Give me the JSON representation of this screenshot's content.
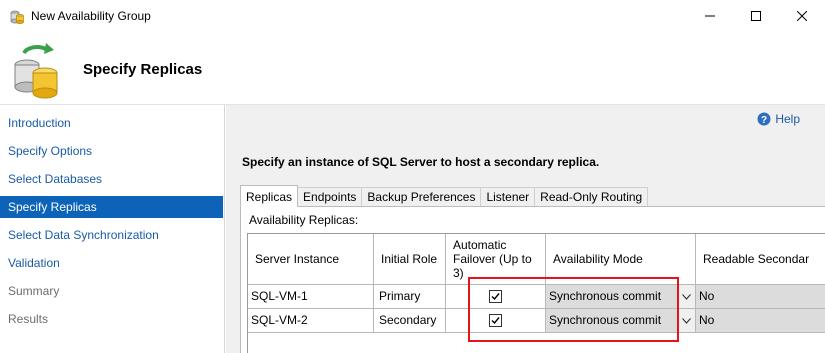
{
  "window": {
    "title": "New Availability Group"
  },
  "header": {
    "title": "Specify Replicas"
  },
  "nav": {
    "items": [
      {
        "label": "Introduction"
      },
      {
        "label": "Specify Options"
      },
      {
        "label": "Select Databases"
      },
      {
        "label": "Specify Replicas"
      },
      {
        "label": "Select Data Synchronization"
      },
      {
        "label": "Validation"
      },
      {
        "label": "Summary"
      },
      {
        "label": "Results"
      }
    ],
    "active": "Specify Replicas"
  },
  "main": {
    "help_label": "Help",
    "instruction": "Specify an instance of SQL Server to host a secondary replica.",
    "tabs": [
      {
        "label": "Replicas"
      },
      {
        "label": "Endpoints"
      },
      {
        "label": "Backup Preferences"
      },
      {
        "label": "Listener"
      },
      {
        "label": "Read-Only Routing"
      }
    ],
    "active_tab": "Replicas",
    "panel_label": "Availability Replicas:",
    "grid": {
      "columns": [
        "Server Instance",
        "Initial Role",
        "Automatic Failover (Up to 3)",
        "Availability Mode",
        "Readable Secondar"
      ],
      "rows": [
        {
          "server": "SQL-VM-1",
          "role": "Primary",
          "auto_failover": true,
          "mode": "Synchronous commit",
          "readable": "No"
        },
        {
          "server": "SQL-VM-2",
          "role": "Secondary",
          "auto_failover": true,
          "mode": "Synchronous commit",
          "readable": "No"
        }
      ]
    }
  },
  "colors": {
    "nav_active": "#0c63b8",
    "link": "#1a5aa8",
    "highlight": "#e3141a"
  }
}
